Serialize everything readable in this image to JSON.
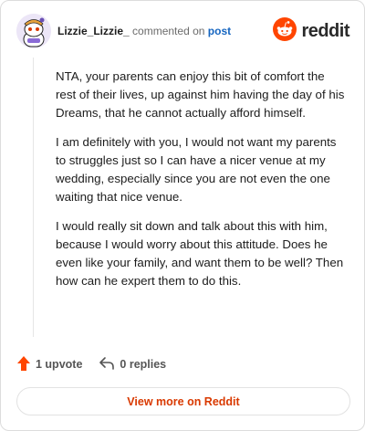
{
  "comment": {
    "author": "Lizzie_Lizzie_",
    "action_text": "commented on",
    "post_link": "post",
    "avatar_icon": "snoo-avatar-icon",
    "paragraphs": [
      "NTA, your parents can enjoy this bit of comfort the rest of their lives, up against him having the day of his Dreams, that he cannot actually afford himself.",
      "I am definitely with you, I would not want my parents to struggles just so I can have a nicer venue at my wedding, especially since you are not even the one waiting that nice venue.",
      "I would really sit down and talk about this with him, because I would worry about this attitude. Does he even like your family, and want them to be well? Then how can he expert them to do this."
    ]
  },
  "brand": {
    "name": "reddit",
    "icon": "reddit-logo-icon",
    "color": "#ff4500"
  },
  "actions": {
    "upvote_label": "1 upvote",
    "upvote_icon": "upvote-arrow-icon",
    "upvote_color": "#ff4500",
    "replies_label": "0 replies",
    "replies_icon": "reply-arrow-icon"
  },
  "footer": {
    "view_more_label": "View more on Reddit",
    "accent": "#d93900"
  }
}
